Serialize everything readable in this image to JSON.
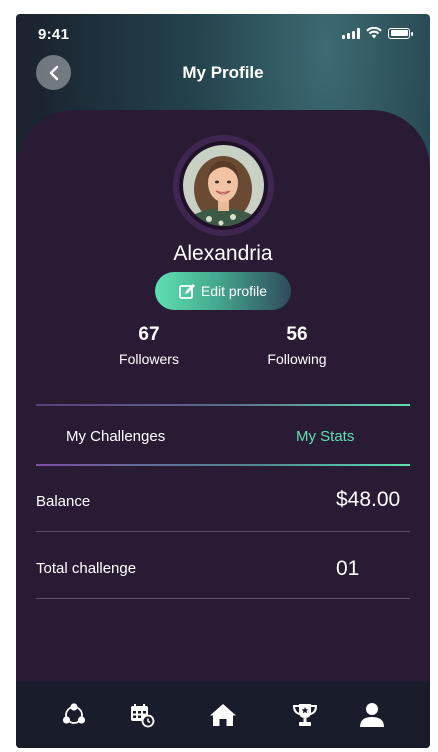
{
  "status_bar": {
    "time": "9:41",
    "icons": [
      "signal-icon",
      "wifi-icon",
      "battery-icon"
    ]
  },
  "header": {
    "title": "My Profile",
    "back_icon": "chevron-left-icon"
  },
  "profile": {
    "name": "Alexandria",
    "edit_label": "Edit profile",
    "edit_icon": "edit-icon",
    "followers": {
      "count": "67",
      "label": "Followers"
    },
    "following": {
      "count": "56",
      "label": "Following"
    }
  },
  "tabs": [
    {
      "label": "My Challenges",
      "active": false
    },
    {
      "label": "My Stats",
      "active": true
    }
  ],
  "stats": [
    {
      "label": "Balance",
      "value": "$48.00"
    },
    {
      "label": "Total challenge",
      "value": "01"
    }
  ],
  "bottom_nav": [
    {
      "icon": "community-icon"
    },
    {
      "icon": "calendar-icon"
    },
    {
      "icon": "home-icon"
    },
    {
      "icon": "trophy-icon"
    },
    {
      "icon": "profile-icon",
      "active": true
    }
  ],
  "colors": {
    "accent": "#5ee0b1",
    "card_bg": "#2a1b35",
    "nav_bg": "#191d2b"
  }
}
